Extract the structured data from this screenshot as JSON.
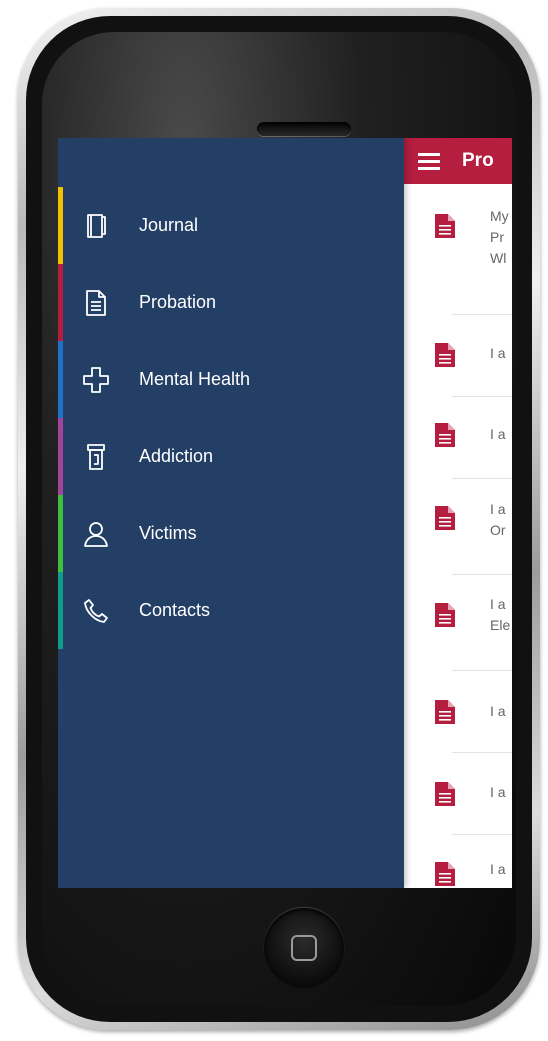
{
  "app": {
    "title": "Pro"
  },
  "drawer": {
    "items": [
      {
        "label": "Journal",
        "icon": "book-icon",
        "accent": "#f2c200"
      },
      {
        "label": "Probation",
        "icon": "document-icon",
        "accent": "#b51e3e"
      },
      {
        "label": "Mental Health",
        "icon": "medical-cross-icon",
        "accent": "#1f73c4"
      },
      {
        "label": "Addiction",
        "icon": "pill-bottle-icon",
        "accent": "#a0459a"
      },
      {
        "label": "Victims",
        "icon": "person-icon",
        "accent": "#3fbf3f"
      },
      {
        "label": "Contacts",
        "icon": "phone-icon",
        "accent": "#129a8c"
      }
    ]
  },
  "list": {
    "items": [
      {
        "text": "My\nPr\nWl"
      },
      {
        "text": "I a"
      },
      {
        "text": "I a"
      },
      {
        "text": "I a\nOr"
      },
      {
        "text": "I a\nEle"
      },
      {
        "text": "I a"
      },
      {
        "text": "I a"
      },
      {
        "text": "I a"
      }
    ]
  },
  "colors": {
    "appbar": "#b51e3e",
    "drawer": "#243f66",
    "doc_icon": "#b51e3e"
  }
}
